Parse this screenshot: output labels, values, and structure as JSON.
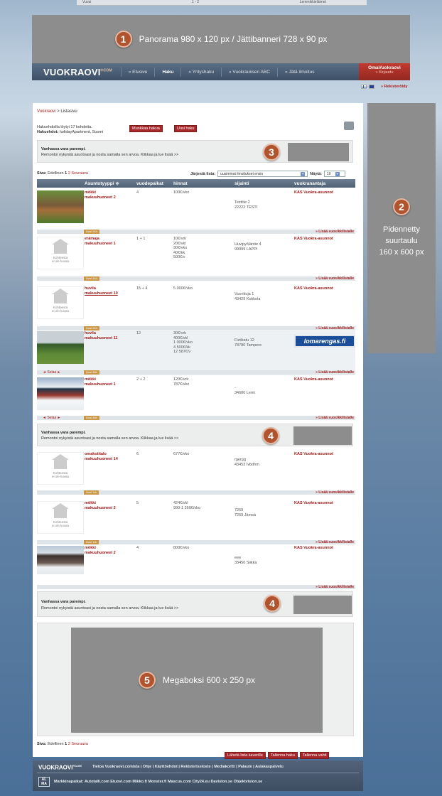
{
  "topstrip": [
    "Vuosi",
    "1 - 2",
    "Lemmikkieläimet"
  ],
  "ads": {
    "panorama": {
      "num": "1",
      "label": "Panorama 980 x 120 px / Jättibanneri 728 x 90 px"
    },
    "side": {
      "num": "2",
      "label_lines": [
        "Pidennetty",
        "suurtaulu",
        "160 x 600 px"
      ]
    },
    "promo3_num": "3",
    "promo4_num": "4",
    "mega": {
      "num": "5",
      "label": "Megaboksi 600 x 250 px"
    }
  },
  "nav": {
    "logo": "VUOKRAOVI",
    "logo_sup": "®COM",
    "items": [
      "» Etusivu",
      "Haku",
      "» Yrityshaku",
      "» Vuokrauksen ABC",
      "» Jätä ilmoitus"
    ],
    "oma_title": "OmaVuokraovi",
    "oma_sub": "» Kirjaudu",
    "rekisteroidy": "» Rekisteröidy"
  },
  "breadcrumb": {
    "link": "Vuokraovi",
    "sep": " > ",
    "current": "Listasivu"
  },
  "result": {
    "line1": "Hakuehdoilla löytyi 17 kohdetta.",
    "line2_label": "Hakuehdot:",
    "line2_value": " holidayApartment, Suomi",
    "edit_button": "Muokkaa hakua",
    "new_button": "Uusi haku"
  },
  "promo": {
    "title": "Vanhassa vara parempi.",
    "text": "Remontoi nykyistä asuntoasi ja nosta samalla sen arvoa. Klikkaa ja lue lisää >>"
  },
  "pager": {
    "label": "Sivu:",
    "prev": "Edellinen",
    "current": "1",
    "next_page": "2",
    "next": "Seuraava"
  },
  "sort": {
    "label": "Järjestä lista:",
    "value": "uusimmat ilmoitukset ensin",
    "show_label": "Näytä:",
    "show_value": "10"
  },
  "table": {
    "headers": [
      "Asuntotyyppi ≑",
      "vuodepaikat",
      "hinnat",
      "sijainti",
      "vuokranantaja"
    ],
    "rows": [
      {
        "type1": "mökki",
        "type2": "makuuhuoneet 2",
        "beds": "4",
        "price": "100€/vko",
        "loc1": "Testitie 2",
        "loc2": "22222 TESTI",
        "landlord": "KAS Vuokra-asunnot",
        "tag": "Uusi 24h"
      },
      {
        "type1": "erämaja",
        "type2": "makuuhuoneet 1",
        "beds": "1 + 1",
        "price": "10€/vrk\n20€/vkl\n30€/vko\n40€/kk\n500€/v",
        "loc1": "Huvipyöläntie 4",
        "loc2": "99999 LAPPI",
        "landlord": "KAS Vuokra-asunnot",
        "tag": "Uusi 24h",
        "noimg": "Kohteesta\nei ole kuvaa"
      },
      {
        "type1": "huvila",
        "type2": "makuuhuoneet 10",
        "beds": "15 + 4",
        "price": "5 000€/vko",
        "loc1": "Vuorikuja 1",
        "loc2": "43429 Kokkola",
        "landlord": "KAS Vuokra-asunnot",
        "tag": "Uusi 24h",
        "noimg": "Kohteesta\nei ole kuvaa"
      },
      {
        "type1": "huvila",
        "type2": "makuuhuoneet 11",
        "beds": "12",
        "price": "30€/vrk\n400€/vkl\n1 000€/vko\n4 500€/kk\n12 587€/v",
        "loc1": "Fiziikatu 12",
        "loc2": "78780 Tampere",
        "landlord": "lomarengas.fi",
        "tag": "Uusi 48h",
        "selaa": "◄ Selaa ►"
      },
      {
        "type1": "mökki",
        "type2": "makuuhuoneet 1",
        "beds": "2 + 2",
        "price": "120€/vrk\n787€/vko",
        "loc1": "-",
        "loc2": "34680 Lemi",
        "landlord": "KAS Vuokra-asunnot",
        "tag": "Uusi 48h",
        "selaa": "◄ Selaa ►"
      },
      {
        "type1": "omakotitalo",
        "type2": "makuuhuoneet 14",
        "beds": "6",
        "price": "677€/vko",
        "loc1": "rgergg",
        "loc2": "43453 Ivbdhm",
        "landlord": "KAS Vuokra-asunnot",
        "tag": "Uusi 1vk",
        "noimg": "Kohteesta\nei ole kuvaa"
      },
      {
        "type1": "mökki",
        "type2": "makuuhuoneet 2",
        "beds": "5",
        "price": "424€/vkl\n990-1 260€/vko",
        "loc1": "7269",
        "loc2": "7269 Jämsä",
        "landlord": "KAS Vuokra-asunnot",
        "tag": "Uusi 1vk",
        "noimg": "Kohteesta\nei ole kuvaa"
      },
      {
        "type1": "mökki",
        "type2": "makuuhuoneet 2",
        "beds": "4",
        "price": "800€/vko",
        "loc1": "eee",
        "loc2": "33450 Siikka",
        "landlord": "KAS Vuokra-asunnot"
      }
    ],
    "fav": "» Lisää suosikkilistalle"
  },
  "bottom_buttons": [
    "Lähetä lista kaverille",
    "Tallenna haku",
    "Tallenna vahti"
  ],
  "footer": {
    "logo": "VUOKRAOVI",
    "logo_sup": "®COM",
    "links": "Tietoa Vuokraovi.comista  |  Ohje  |  Käyttöehdot  |  Rekisteriseloste  |  Mediakortti  |  Palaute  |  Asiakaspalvelu",
    "am": "AL\nMA",
    "market_label": "Markkinapaikat:",
    "market_links": " Autotalli.com Etuovi.com Mikko.fi Monster.fi Mascus.com City24.eu Davision.se Objektvision.se"
  }
}
